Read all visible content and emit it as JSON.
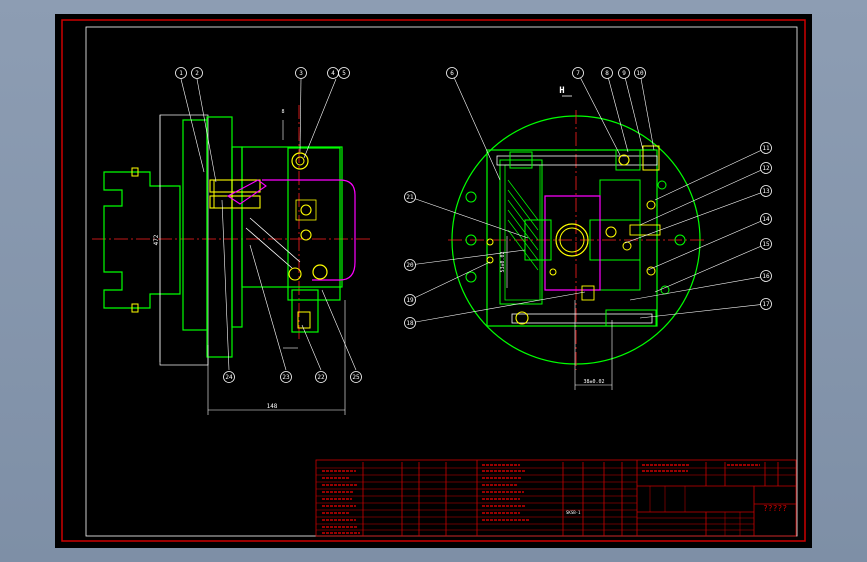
{
  "drawing": {
    "view_label": "H",
    "balloons": [
      "1",
      "2",
      "3",
      "4",
      "5",
      "6",
      "7",
      "8",
      "9",
      "10",
      "11",
      "12",
      "13",
      "14",
      "15",
      "16",
      "17",
      "18",
      "19",
      "20",
      "21",
      "22",
      "23",
      "24",
      "25"
    ],
    "dims": {
      "left_width": "148",
      "left_height": "472",
      "right_vertical": "53±0.02",
      "right_bottom": "38±0.02",
      "left_small": "8"
    }
  },
  "title_block": {
    "name": "?????",
    "drawing_no": "SKSB-1"
  },
  "colors": {
    "background": "#000000",
    "frame": "#cc0000",
    "outline": "#00ff00",
    "center_line": "#ff2020",
    "accent": "#ff00ff",
    "part": "#ffff00",
    "dimension": "#ffffff"
  }
}
